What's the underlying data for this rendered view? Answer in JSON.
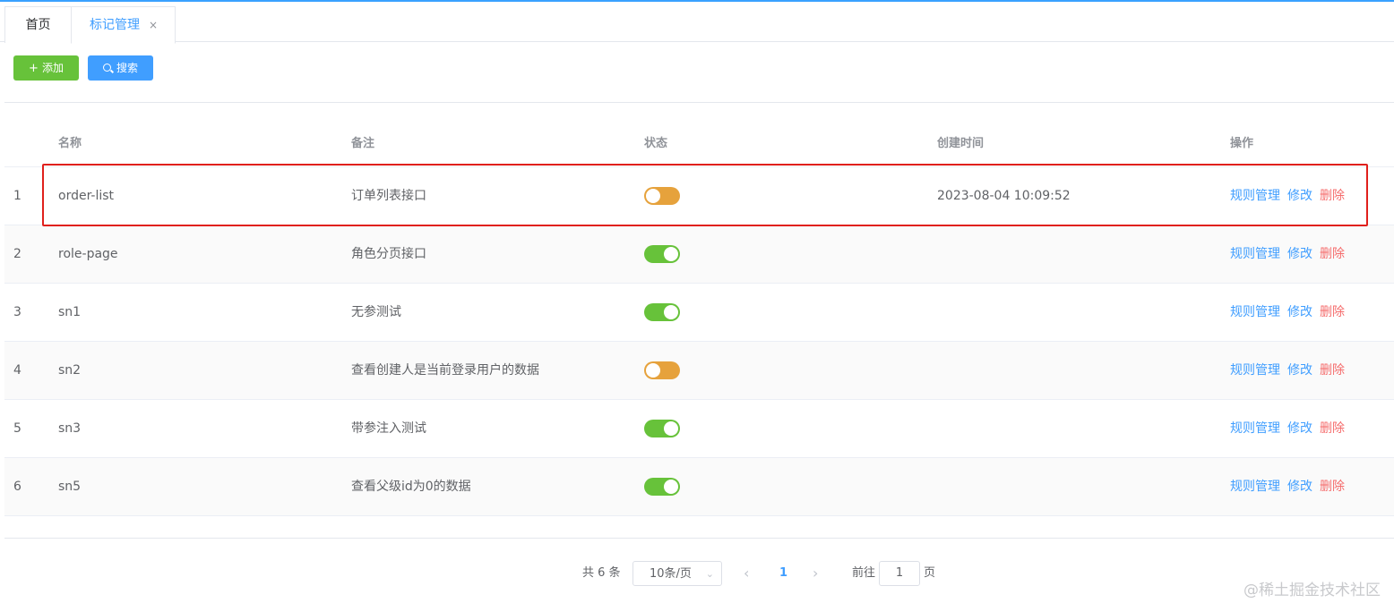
{
  "tabs": [
    {
      "label": "首页"
    },
    {
      "label": "标记管理",
      "close": "×"
    }
  ],
  "toolbar": {
    "add_label": "添加",
    "add_icon": "+",
    "search_label": "搜索"
  },
  "table": {
    "headers": {
      "name": "名称",
      "note": "备注",
      "status": "状态",
      "created": "创建时间",
      "ops": "操作"
    },
    "rows": [
      {
        "index": "1",
        "name": "order-list",
        "note": "订单列表接口",
        "status": "off",
        "created": "2023-08-04 10:09:52"
      },
      {
        "index": "2",
        "name": "role-page",
        "note": "角色分页接口",
        "status": "on",
        "created": ""
      },
      {
        "index": "3",
        "name": "sn1",
        "note": "无参测试",
        "status": "on",
        "created": ""
      },
      {
        "index": "4",
        "name": "sn2",
        "note": "查看创建人是当前登录用户的数据",
        "status": "off",
        "created": ""
      },
      {
        "index": "5",
        "name": "sn3",
        "note": "带参注入测试",
        "status": "on",
        "created": ""
      },
      {
        "index": "6",
        "name": "sn5",
        "note": "查看父级id为0的数据",
        "status": "on",
        "created": ""
      }
    ],
    "ops": {
      "rules": "规则管理",
      "edit": "修改",
      "delete": "删除"
    }
  },
  "pagination": {
    "total": "共 6 条",
    "page_size": "10条/页",
    "current": "1",
    "goto": "前往",
    "goto_value": "1",
    "page_suffix": "页"
  },
  "watermark": "@稀土掘金技术社区",
  "colors": {
    "primary": "#409eff",
    "success": "#67c23a",
    "warning": "#e6a23c",
    "danger": "#f56c6c",
    "highlight": "#e0201c"
  }
}
